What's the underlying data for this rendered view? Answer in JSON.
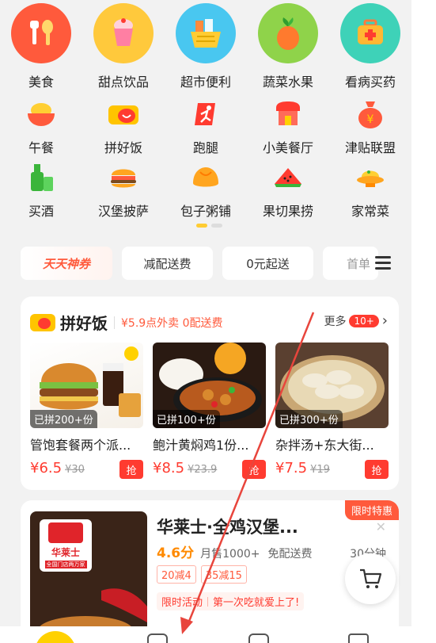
{
  "categories_row1": [
    "美食",
    "甜点饮品",
    "超市便利",
    "蔬菜水果",
    "看病买药"
  ],
  "categories_row2": [
    "午餐",
    "拼好饭",
    "跑腿",
    "小美餐厅",
    "津贴联盟"
  ],
  "categories_row3": [
    "买酒",
    "汉堡披萨",
    "包子粥铺",
    "果切果捞",
    "家常菜"
  ],
  "filters": [
    "天天神券",
    "减配送费",
    "0元起送",
    "首单"
  ],
  "pinhaofan": {
    "title": "拼好饭",
    "subtitle": "¥5.9点外卖 0配送费",
    "more": "更多",
    "more_badge": "10+",
    "products": [
      {
        "tag": "已拼200+份",
        "name": "管饱套餐两个派...",
        "price": "¥6.5",
        "old": "¥30",
        "grab": "抢"
      },
      {
        "tag": "已拼100+份",
        "name": "鲍汁黄焖鸡1份...",
        "price": "¥8.5",
        "old": "¥23.9",
        "grab": "抢"
      },
      {
        "tag": "已拼300+份",
        "name": "杂拌汤+东大街...",
        "price": "¥7.5",
        "old": "¥19",
        "grab": "抢"
      }
    ]
  },
  "restaurant": {
    "badge": "限时特惠",
    "name": "华莱士·全鸡汉堡...",
    "logo_name": "华莱士",
    "logo_sub": "全国门店两万家",
    "score": "4.6分",
    "sales": "月售1000+",
    "delivery": "免配送费",
    "time": "30分钟",
    "tags": [
      "20减4",
      "35减15"
    ],
    "promo_label": "限时活动",
    "promo_text": "第一次吃就爱上了!"
  },
  "colors": {
    "accent": "#ff3b30",
    "brand_yellow": "#ffd100",
    "annotation_arrow": "#e8453c"
  }
}
